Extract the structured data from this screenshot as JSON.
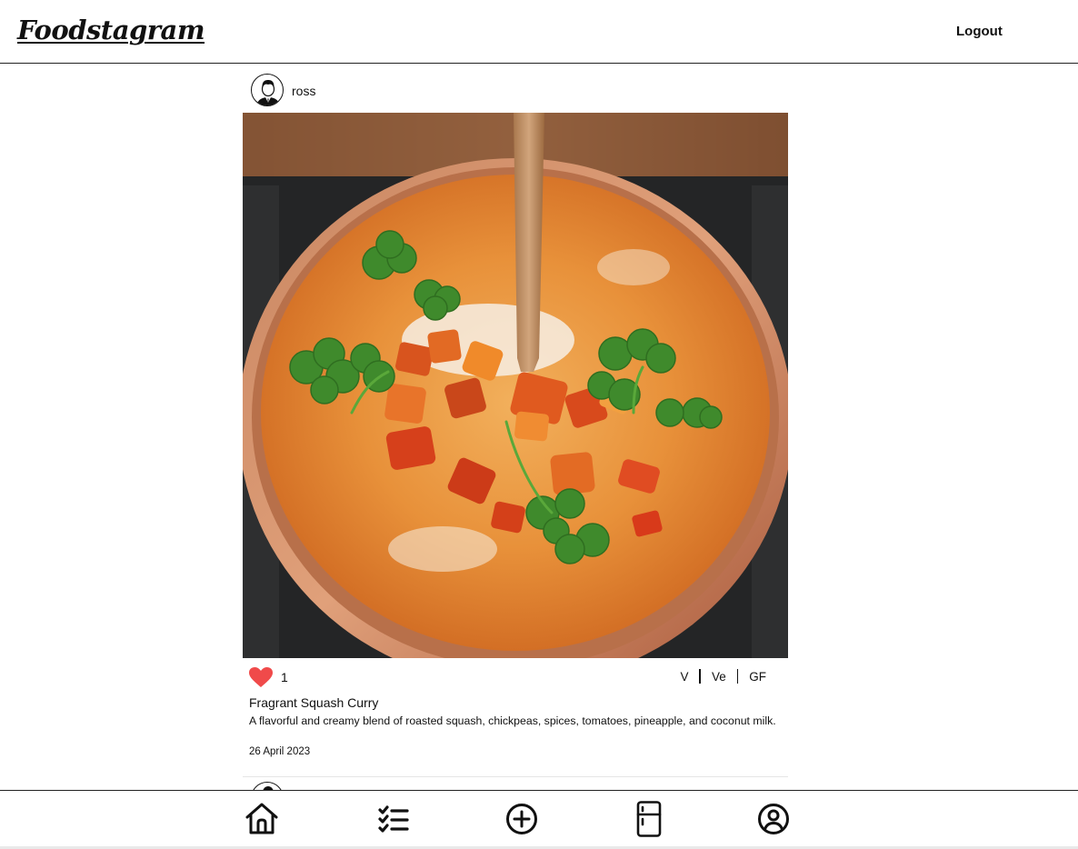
{
  "app": {
    "logo": "Foodstagram"
  },
  "header": {
    "logout_label": "Logout"
  },
  "post": {
    "username": "ross",
    "image_alt": "Fragrant Squash Curry",
    "likes": "1",
    "liked": true,
    "tags": [
      "V",
      "Ve",
      "GF"
    ],
    "title": "Fragrant Squash Curry",
    "description": "A flavorful and creamy blend of roasted squash, chickpeas, spices, tomatoes, pineapple, and coconut milk.",
    "date": "26 April 2023"
  },
  "nav": {
    "items": [
      {
        "icon": "home-icon"
      },
      {
        "icon": "checklist-icon"
      },
      {
        "icon": "add-circle-icon"
      },
      {
        "icon": "fridge-icon"
      },
      {
        "icon": "profile-icon"
      }
    ]
  },
  "colors": {
    "heart": "#f04a4a",
    "border": "#222222"
  }
}
